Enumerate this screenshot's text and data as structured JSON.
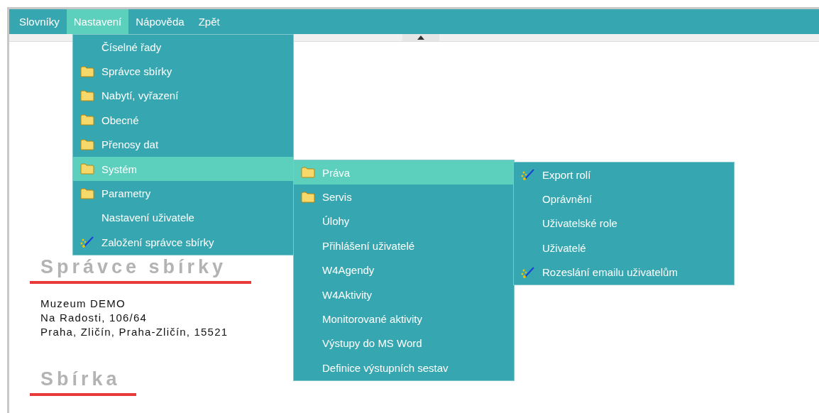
{
  "menubar": [
    {
      "label": "Slovníky",
      "selected": false
    },
    {
      "label": "Nastavení",
      "selected": true
    },
    {
      "label": "Nápověda",
      "selected": false
    },
    {
      "label": "Zpět",
      "selected": false
    }
  ],
  "menus": [
    {
      "items": [
        {
          "label": "Číselné řady",
          "kind": "plain",
          "selected": false
        },
        {
          "label": "Správce sbírky",
          "kind": "folder",
          "selected": false
        },
        {
          "label": "Nabytí, vyřazení",
          "kind": "folder",
          "selected": false
        },
        {
          "label": "Obecné",
          "kind": "folder",
          "selected": false
        },
        {
          "label": "Přenosy dat",
          "kind": "folder",
          "selected": false
        },
        {
          "label": "Systém",
          "kind": "folder",
          "selected": true
        },
        {
          "label": "Parametry",
          "kind": "folder",
          "selected": false
        },
        {
          "label": "Nastavení uživatele",
          "kind": "plain",
          "selected": false
        },
        {
          "label": "Založení správce sbírky",
          "kind": "wand",
          "selected": false
        }
      ]
    },
    {
      "items": [
        {
          "label": "Práva",
          "kind": "folder",
          "selected": true
        },
        {
          "label": "Servis",
          "kind": "folder",
          "selected": false
        },
        {
          "label": "Úlohy",
          "kind": "plain",
          "selected": false
        },
        {
          "label": "Přihlášení uživatelé",
          "kind": "plain",
          "selected": false
        },
        {
          "label": "W4Agendy",
          "kind": "plain",
          "selected": false
        },
        {
          "label": "W4Aktivity",
          "kind": "plain",
          "selected": false
        },
        {
          "label": "Monitorované aktivity",
          "kind": "plain",
          "selected": false
        },
        {
          "label": "Výstupy do MS Word",
          "kind": "plain",
          "selected": false
        },
        {
          "label": "Definice výstupních sestav",
          "kind": "plain",
          "selected": false
        }
      ]
    },
    {
      "items": [
        {
          "label": "Export rolí",
          "kind": "wand",
          "selected": false
        },
        {
          "label": "Oprávnění",
          "kind": "plain",
          "selected": false
        },
        {
          "label": "Uživatelské role",
          "kind": "plain",
          "selected": false
        },
        {
          "label": "Uživatelé",
          "kind": "plain",
          "selected": false
        },
        {
          "label": "Rozeslání emailu uživatelům",
          "kind": "wand",
          "selected": false
        }
      ]
    }
  ],
  "sections": [
    {
      "title": "Správce sbírky",
      "lines": [
        "Muzeum DEMO",
        "Na Radosti, 106/64",
        "Praha, Zličín, Praha-Zličín, 15521"
      ]
    },
    {
      "title": "Sbírka"
    }
  ]
}
